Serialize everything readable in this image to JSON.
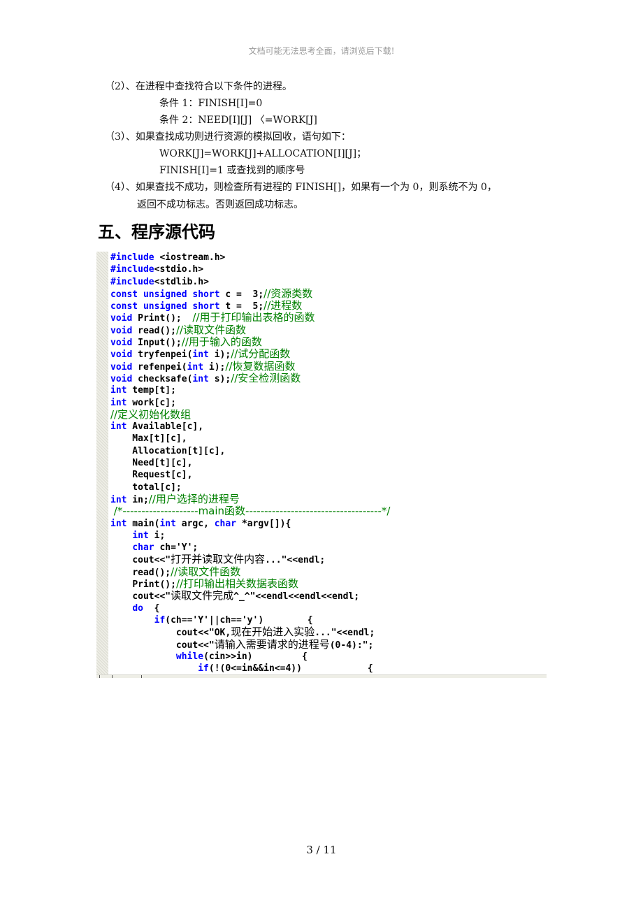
{
  "watermark": "文档可能无法思考全面，请浏览后下载!",
  "steps": [
    "（2）、在进程中查找符合以下条件的进程。",
    "条件 1：FINISH[I]=0",
    "条件 2：NEED[I][J] 〈=WORK[J]",
    "（3）、如果查找成功则进行资源的模拟回收，语句如下：",
    "WORK[J]=WORK[J]+ALLOCATION[I][J]；",
    "FINISH[I]=1 或查找到的顺序号",
    "（4）、如果查找不成功，则检查所有进程的 FINISH[]，如果有一个为 0，则系统不为 0，",
    "返回不成功标志。否则返回成功标志。"
  ],
  "section_heading": "五、程序源代码",
  "code": [
    {
      "kw": "#include",
      "text": " <iostream.h>",
      "comment": ""
    },
    {
      "kw": "#include",
      "text": "<stdio.h>",
      "comment": ""
    },
    {
      "kw": "#include",
      "text": "<stdlib.h>",
      "comment": ""
    },
    {
      "kw": "const unsigned short",
      "text": " c =  3;",
      "comment": "//资源类数"
    },
    {
      "kw": "const unsigned short",
      "text": " t =  5;",
      "comment": "//进程数"
    },
    {
      "kw": "void",
      "text": " Print();  ",
      "comment": "//用于打印输出表格的函数"
    },
    {
      "kw": "void",
      "text": " read();",
      "comment": "//读取文件函数"
    },
    {
      "kw": "void",
      "text": " Input();",
      "comment": "//用于输入的函数"
    },
    {
      "kw": "void",
      "text": " tryfenpei(",
      "kw2": "int",
      "text2": " i);",
      "comment": "//试分配函数"
    },
    {
      "kw": "void",
      "text": " refenpei(",
      "kw2": "int",
      "text2": " i);",
      "comment": "//恢复数据函数"
    },
    {
      "kw": "void",
      "text": " checksafe(",
      "kw2": "int",
      "text2": " s);",
      "comment": "//安全检测函数"
    },
    {
      "kw": "int",
      "text": " temp[t];",
      "comment": ""
    },
    {
      "kw": "int",
      "text": " work[c];",
      "comment": ""
    },
    {
      "kw": "",
      "text": "",
      "comment": "//定义初始化数组"
    },
    {
      "kw": "int",
      "text": " Available[c],",
      "comment": ""
    },
    {
      "kw": "",
      "text": "    Max[t][c],",
      "comment": ""
    },
    {
      "kw": "",
      "text": "    Allocation[t][c],",
      "comment": ""
    },
    {
      "kw": "",
      "text": "    Need[t][c],",
      "comment": ""
    },
    {
      "kw": "",
      "text": "    Request[c],",
      "comment": ""
    },
    {
      "kw": "",
      "text": "    total[c];",
      "comment": ""
    },
    {
      "kw": "int",
      "text": " in;",
      "comment": "//用户选择的进程号"
    },
    {
      "kw": "",
      "text": "",
      "comment": " /*--------------------main函数------------------------------------*/"
    },
    {
      "kw": "int",
      "text": " main(",
      "kw2": "int",
      "text2": " argc, ",
      "kw3": "char",
      "text3": " *argv[]){",
      "comment": ""
    },
    {
      "indent": "    ",
      "kw": "int",
      "text": " i;",
      "comment": ""
    },
    {
      "indent": "    ",
      "kw": "char",
      "text": " ch='Y';",
      "comment": ""
    },
    {
      "indent": "    ",
      "kw": "",
      "text": "cout<<\"",
      "zh": "打开并读取文件内容",
      "text_after": "...\"<<endl;",
      "comment": ""
    },
    {
      "indent": "    ",
      "kw": "",
      "text": "read();",
      "comment": "//读取文件函数"
    },
    {
      "indent": "    ",
      "kw": "",
      "text": "Print();",
      "comment": "//打印输出相关数据表函数"
    },
    {
      "indent": "    ",
      "kw": "",
      "text": "cout<<\"",
      "zh": "读取文件完成",
      "text_after": "^_^\"<<endl<<endl<<endl;",
      "comment": ""
    },
    {
      "indent": "    ",
      "kw": "do",
      "text": "  {",
      "comment": ""
    },
    {
      "indent": "        ",
      "kw": "if",
      "text": "(ch=='Y'||ch=='y')        {",
      "comment": ""
    },
    {
      "indent": "            ",
      "kw": "",
      "text": "cout<<\"OK,",
      "zh": "现在开始进入实验",
      "text_after": "...\"<<endl;",
      "comment": ""
    },
    {
      "indent": "            ",
      "kw": "",
      "text": "cout<<\"",
      "zh": "请输入需要请求的进程号",
      "text_after": "(0-4):\";",
      "comment": ""
    },
    {
      "indent": "            ",
      "kw": "while",
      "text": "(cin>>in)         {",
      "comment": ""
    },
    {
      "indent": "                ",
      "kw": "if",
      "text": "(!(0<=in&&in<=4))            {",
      "comment": ""
    }
  ],
  "colors": {
    "keyword": "#0000ff",
    "comment": "#008000",
    "watermark": "#9a9a9a"
  },
  "page_number": "3 / 11"
}
